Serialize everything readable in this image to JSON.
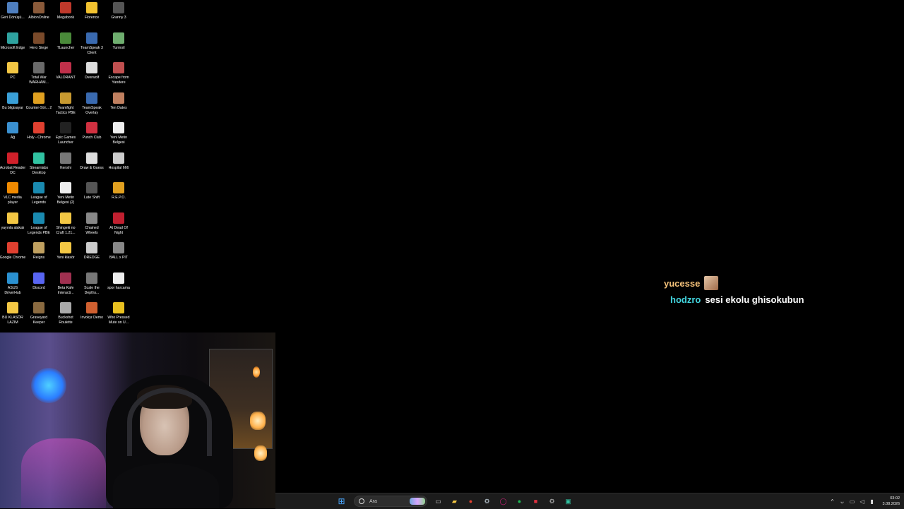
{
  "desktop_icons": [
    {
      "label": "Geri Dönüşü...",
      "icon": "recycle-bin-icon",
      "color": "#4f7fbf"
    },
    {
      "label": "AlbionOnline",
      "icon": "albion-online-icon",
      "color": "#8a5a3a"
    },
    {
      "label": "Megabonk",
      "icon": "megabonk-icon",
      "color": "#c0392b"
    },
    {
      "label": "Florence",
      "icon": "florence-icon",
      "color": "#f2c230"
    },
    {
      "label": "Granny 3",
      "icon": "granny-icon",
      "color": "#555555"
    },
    {
      "label": "Microsoft Edge",
      "icon": "edge-icon",
      "color": "#2fa3a0"
    },
    {
      "label": "Hero Siege",
      "icon": "hero-siege-icon",
      "color": "#7a4a2a"
    },
    {
      "label": "TLauncher",
      "icon": "tlauncher-icon",
      "color": "#4a8a3a"
    },
    {
      "label": "TeamSpeak 3 Client",
      "icon": "teamspeak-icon",
      "color": "#3a6ab0"
    },
    {
      "label": "Turmoil",
      "icon": "turmoil-icon",
      "color": "#6fae6f"
    },
    {
      "label": "PC",
      "icon": "folder-icon",
      "color": "#f3c744"
    },
    {
      "label": "Total War WARHAM...",
      "icon": "total-war-icon",
      "color": "#6a6a6a"
    },
    {
      "label": "VALORANT",
      "icon": "valorant-icon",
      "color": "#c0304a"
    },
    {
      "label": "Overwolf",
      "icon": "overwolf-icon",
      "color": "#dddddd"
    },
    {
      "label": "Escape from Yandere",
      "icon": "escape-yandere-icon",
      "color": "#c05050"
    },
    {
      "label": "Bu bilgisayar",
      "icon": "this-pc-icon",
      "color": "#3aa0d8"
    },
    {
      "label": "Counter-Stri... 2",
      "icon": "counter-strike-icon",
      "color": "#e0a020"
    },
    {
      "label": "Teamfight Tactics PBE",
      "icon": "teamfight-tactics-icon",
      "color": "#c89a30"
    },
    {
      "label": "TeamSpeak Overlay",
      "icon": "teamspeak-overlay-icon",
      "color": "#3a6ab0"
    },
    {
      "label": "Ten Dates",
      "icon": "ten-dates-icon",
      "color": "#c08060"
    },
    {
      "label": "Ağ",
      "icon": "network-icon",
      "color": "#3a90d0"
    },
    {
      "label": "Holy - Chrome",
      "icon": "chrome-icon",
      "color": "#e04030"
    },
    {
      "label": "Epic Games Launcher",
      "icon": "epic-games-icon",
      "color": "#222222"
    },
    {
      "label": "Punch Club",
      "icon": "punch-club-icon",
      "color": "#d03040"
    },
    {
      "label": "Yeni Metin Belgesi",
      "icon": "text-file-icon",
      "color": "#eeeeee"
    },
    {
      "label": "Acrobat Reader DC",
      "icon": "acrobat-icon",
      "color": "#d0202a"
    },
    {
      "label": "Streamlabs Desktop",
      "icon": "streamlabs-icon",
      "color": "#31c3a2"
    },
    {
      "label": "Kenshi",
      "icon": "kenshi-icon",
      "color": "#777777"
    },
    {
      "label": "Draw & Guess",
      "icon": "draw-guess-icon",
      "color": "#dddddd"
    },
    {
      "label": "Hospital 666",
      "icon": "hospital-666-icon",
      "color": "#cccccc"
    },
    {
      "label": "VLC media player",
      "icon": "vlc-icon",
      "color": "#f08a00"
    },
    {
      "label": "League of Legends",
      "icon": "league-icon",
      "color": "#1a8ab0"
    },
    {
      "label": "Yeni Metin Belgesi (2)",
      "icon": "text-file-icon",
      "color": "#eeeeee"
    },
    {
      "label": "Late Shift",
      "icon": "late-shift-icon",
      "color": "#555555"
    },
    {
      "label": "R.E.P.O.",
      "icon": "repo-icon",
      "color": "#e0a020"
    },
    {
      "label": "yayınla alakalı",
      "icon": "folder-icon",
      "color": "#f3c744"
    },
    {
      "label": "League of Legends PBE",
      "icon": "league-pbe-icon",
      "color": "#1a8ab0"
    },
    {
      "label": "Shingeki no Craft 1.21...",
      "icon": "folder-icon",
      "color": "#f3c744"
    },
    {
      "label": "Chained Wheels",
      "icon": "chained-wheels-icon",
      "color": "#888888"
    },
    {
      "label": "At Dead Of Night",
      "icon": "at-dead-of-night-icon",
      "color": "#c02030"
    },
    {
      "label": "Google Chrome",
      "icon": "chrome-icon",
      "color": "#e04030"
    },
    {
      "label": "Reigns",
      "icon": "reigns-icon",
      "color": "#c0a060"
    },
    {
      "label": "Yeni klasör",
      "icon": "folder-icon",
      "color": "#f3c744"
    },
    {
      "label": "DREDGE",
      "icon": "dredge-icon",
      "color": "#cccccc"
    },
    {
      "label": "BALL x PIT",
      "icon": "ball-x-pit-icon",
      "color": "#888888"
    },
    {
      "label": "ASUS DriverHub",
      "icon": "asus-icon",
      "color": "#2a90d0"
    },
    {
      "label": "Discord",
      "icon": "discord-icon",
      "color": "#5865f2"
    },
    {
      "label": "Beta Kafe Interacti...",
      "icon": "beta-kafe-icon",
      "color": "#a03050"
    },
    {
      "label": "Scale the Depths...",
      "icon": "scale-depths-icon",
      "color": "#777777"
    },
    {
      "label": "spor harcama",
      "icon": "text-file-icon",
      "color": "#eeeeee"
    },
    {
      "label": "BU KLASÖR LAZIM",
      "icon": "folder-icon",
      "color": "#f3c744"
    },
    {
      "label": "Graveyard Keeper",
      "icon": "graveyard-keeper-icon",
      "color": "#8a6a40"
    },
    {
      "label": "Buckshot Roulette",
      "icon": "buckshot-roulette-icon",
      "color": "#aaaaaa"
    },
    {
      "label": "Invokyr Demo",
      "icon": "invokyr-icon",
      "color": "#d06030"
    },
    {
      "label": "Who Pressed Mute on U...",
      "icon": "who-pressed-mute-icon",
      "color": "#e8c020"
    }
  ],
  "chat": [
    {
      "user": "yucesse",
      "user_color": "#f5c27a",
      "message": "",
      "has_avatar": true
    },
    {
      "user": "hodzro",
      "user_color": "#43d6e0",
      "message": "sesi ekolu ghisokubun",
      "has_avatar": false
    }
  ],
  "taskbar": {
    "search_placeholder": "Ara",
    "apps": [
      {
        "name": "start-icon",
        "color": "#4aa8ff",
        "glyph": "⊞"
      },
      {
        "name": "task-view-icon",
        "color": "#cccccc",
        "glyph": "▭"
      },
      {
        "name": "file-explorer-icon",
        "color": "#f3c744",
        "glyph": "▰"
      },
      {
        "name": "chrome-icon",
        "color": "#e04030",
        "glyph": "●"
      },
      {
        "name": "steam-icon",
        "color": "#c7d5e0",
        "glyph": "⚙"
      },
      {
        "name": "opera-gx-icon",
        "color": "#d0207a",
        "glyph": "◯"
      },
      {
        "name": "spotify-icon",
        "color": "#1db954",
        "glyph": "●"
      },
      {
        "name": "recorder-icon",
        "color": "#e03040",
        "glyph": "■"
      },
      {
        "name": "settings-icon",
        "color": "#bbbbbb",
        "glyph": "⚙"
      },
      {
        "name": "streamlabs-icon",
        "color": "#31c3a2",
        "glyph": "▣"
      }
    ],
    "tray": {
      "time": "03:02",
      "date": "3.08.2026"
    }
  }
}
